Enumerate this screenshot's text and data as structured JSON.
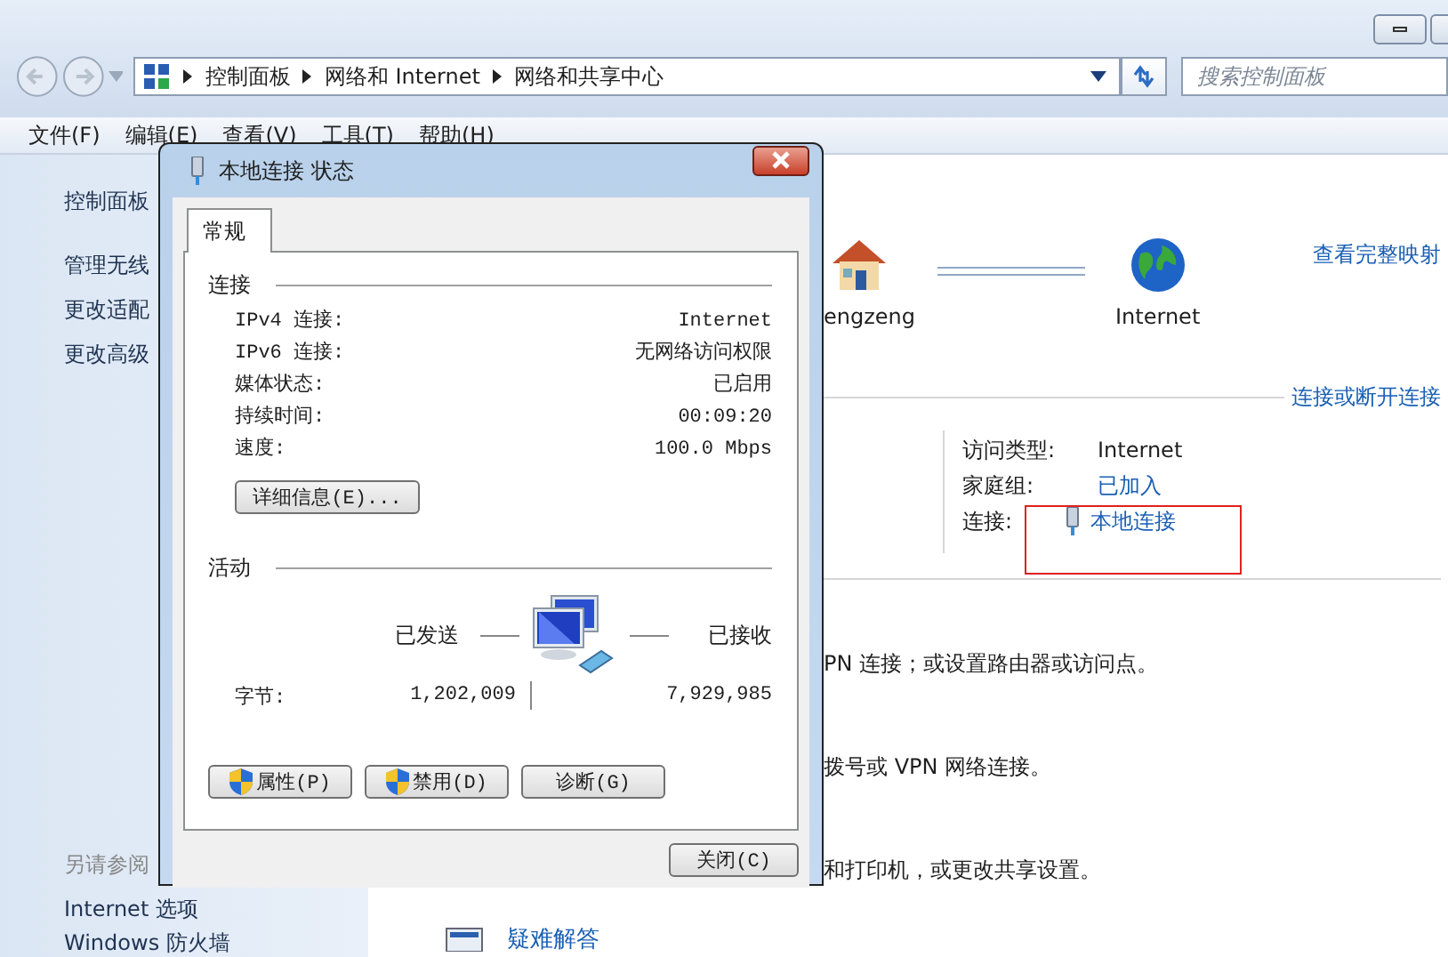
{
  "address_bar": {
    "breadcrumbs": [
      "控制面板",
      "网络和 Internet",
      "网络和共享中心"
    ]
  },
  "search": {
    "placeholder": "搜索控制面板"
  },
  "menu": [
    "文件(F)",
    "编辑(E)",
    "查看(V)",
    "工具(T)",
    "帮助(H)"
  ],
  "sidebar": {
    "items": [
      "控制面板",
      "管理无线",
      "更改适配",
      "更改高级"
    ],
    "see_also": {
      "heading": "另请参阅",
      "items": [
        "Internet 选项",
        "Windows 防火墙"
      ]
    }
  },
  "network_map": {
    "nodes": [
      {
        "label": "engzeng",
        "kind": "house"
      },
      {
        "label": "Internet",
        "kind": "globe"
      }
    ],
    "link": "查看完整映射"
  },
  "connect_link": "连接或断开连接",
  "network_info": [
    {
      "label": "访问类型:",
      "value": "Internet",
      "kind": "text"
    },
    {
      "label": "家庭组:",
      "value": "已加入",
      "kind": "link"
    },
    {
      "label": "连接:",
      "value": "本地连接",
      "kind": "connection"
    }
  ],
  "descriptions": [
    "PN 连接；或设置路由器或访问点。",
    "拨号或 VPN 网络连接。",
    "和打印机，或更改共享设置。"
  ],
  "troubleshoot_link": "疑难解答",
  "dialog": {
    "title": "本地连接 状态",
    "tabs": [
      {
        "label": "常规",
        "selected": true
      }
    ],
    "connection": {
      "heading": "连接",
      "rows": [
        {
          "label": "IPv4 连接:",
          "value": "Internet"
        },
        {
          "label": "IPv6 连接:",
          "value": "无网络访问权限"
        },
        {
          "label": "媒体状态:",
          "value": "已启用"
        },
        {
          "label": "持续时间:",
          "value": "00:09:20"
        },
        {
          "label": "速度:",
          "value": "100.0 Mbps"
        }
      ],
      "details_button": "详细信息(E)..."
    },
    "activity": {
      "heading": "活动",
      "sent_label": "已发送",
      "received_label": "已接收",
      "bytes_label": "字节:",
      "sent": "1,202,009",
      "received": "7,929,985"
    },
    "buttons": [
      {
        "label": "属性(P)",
        "kind": "shield"
      },
      {
        "label": "禁用(D)",
        "kind": "shield"
      },
      {
        "label": "诊断(G)",
        "kind": "plain"
      }
    ],
    "close_button": "关闭(C)"
  }
}
